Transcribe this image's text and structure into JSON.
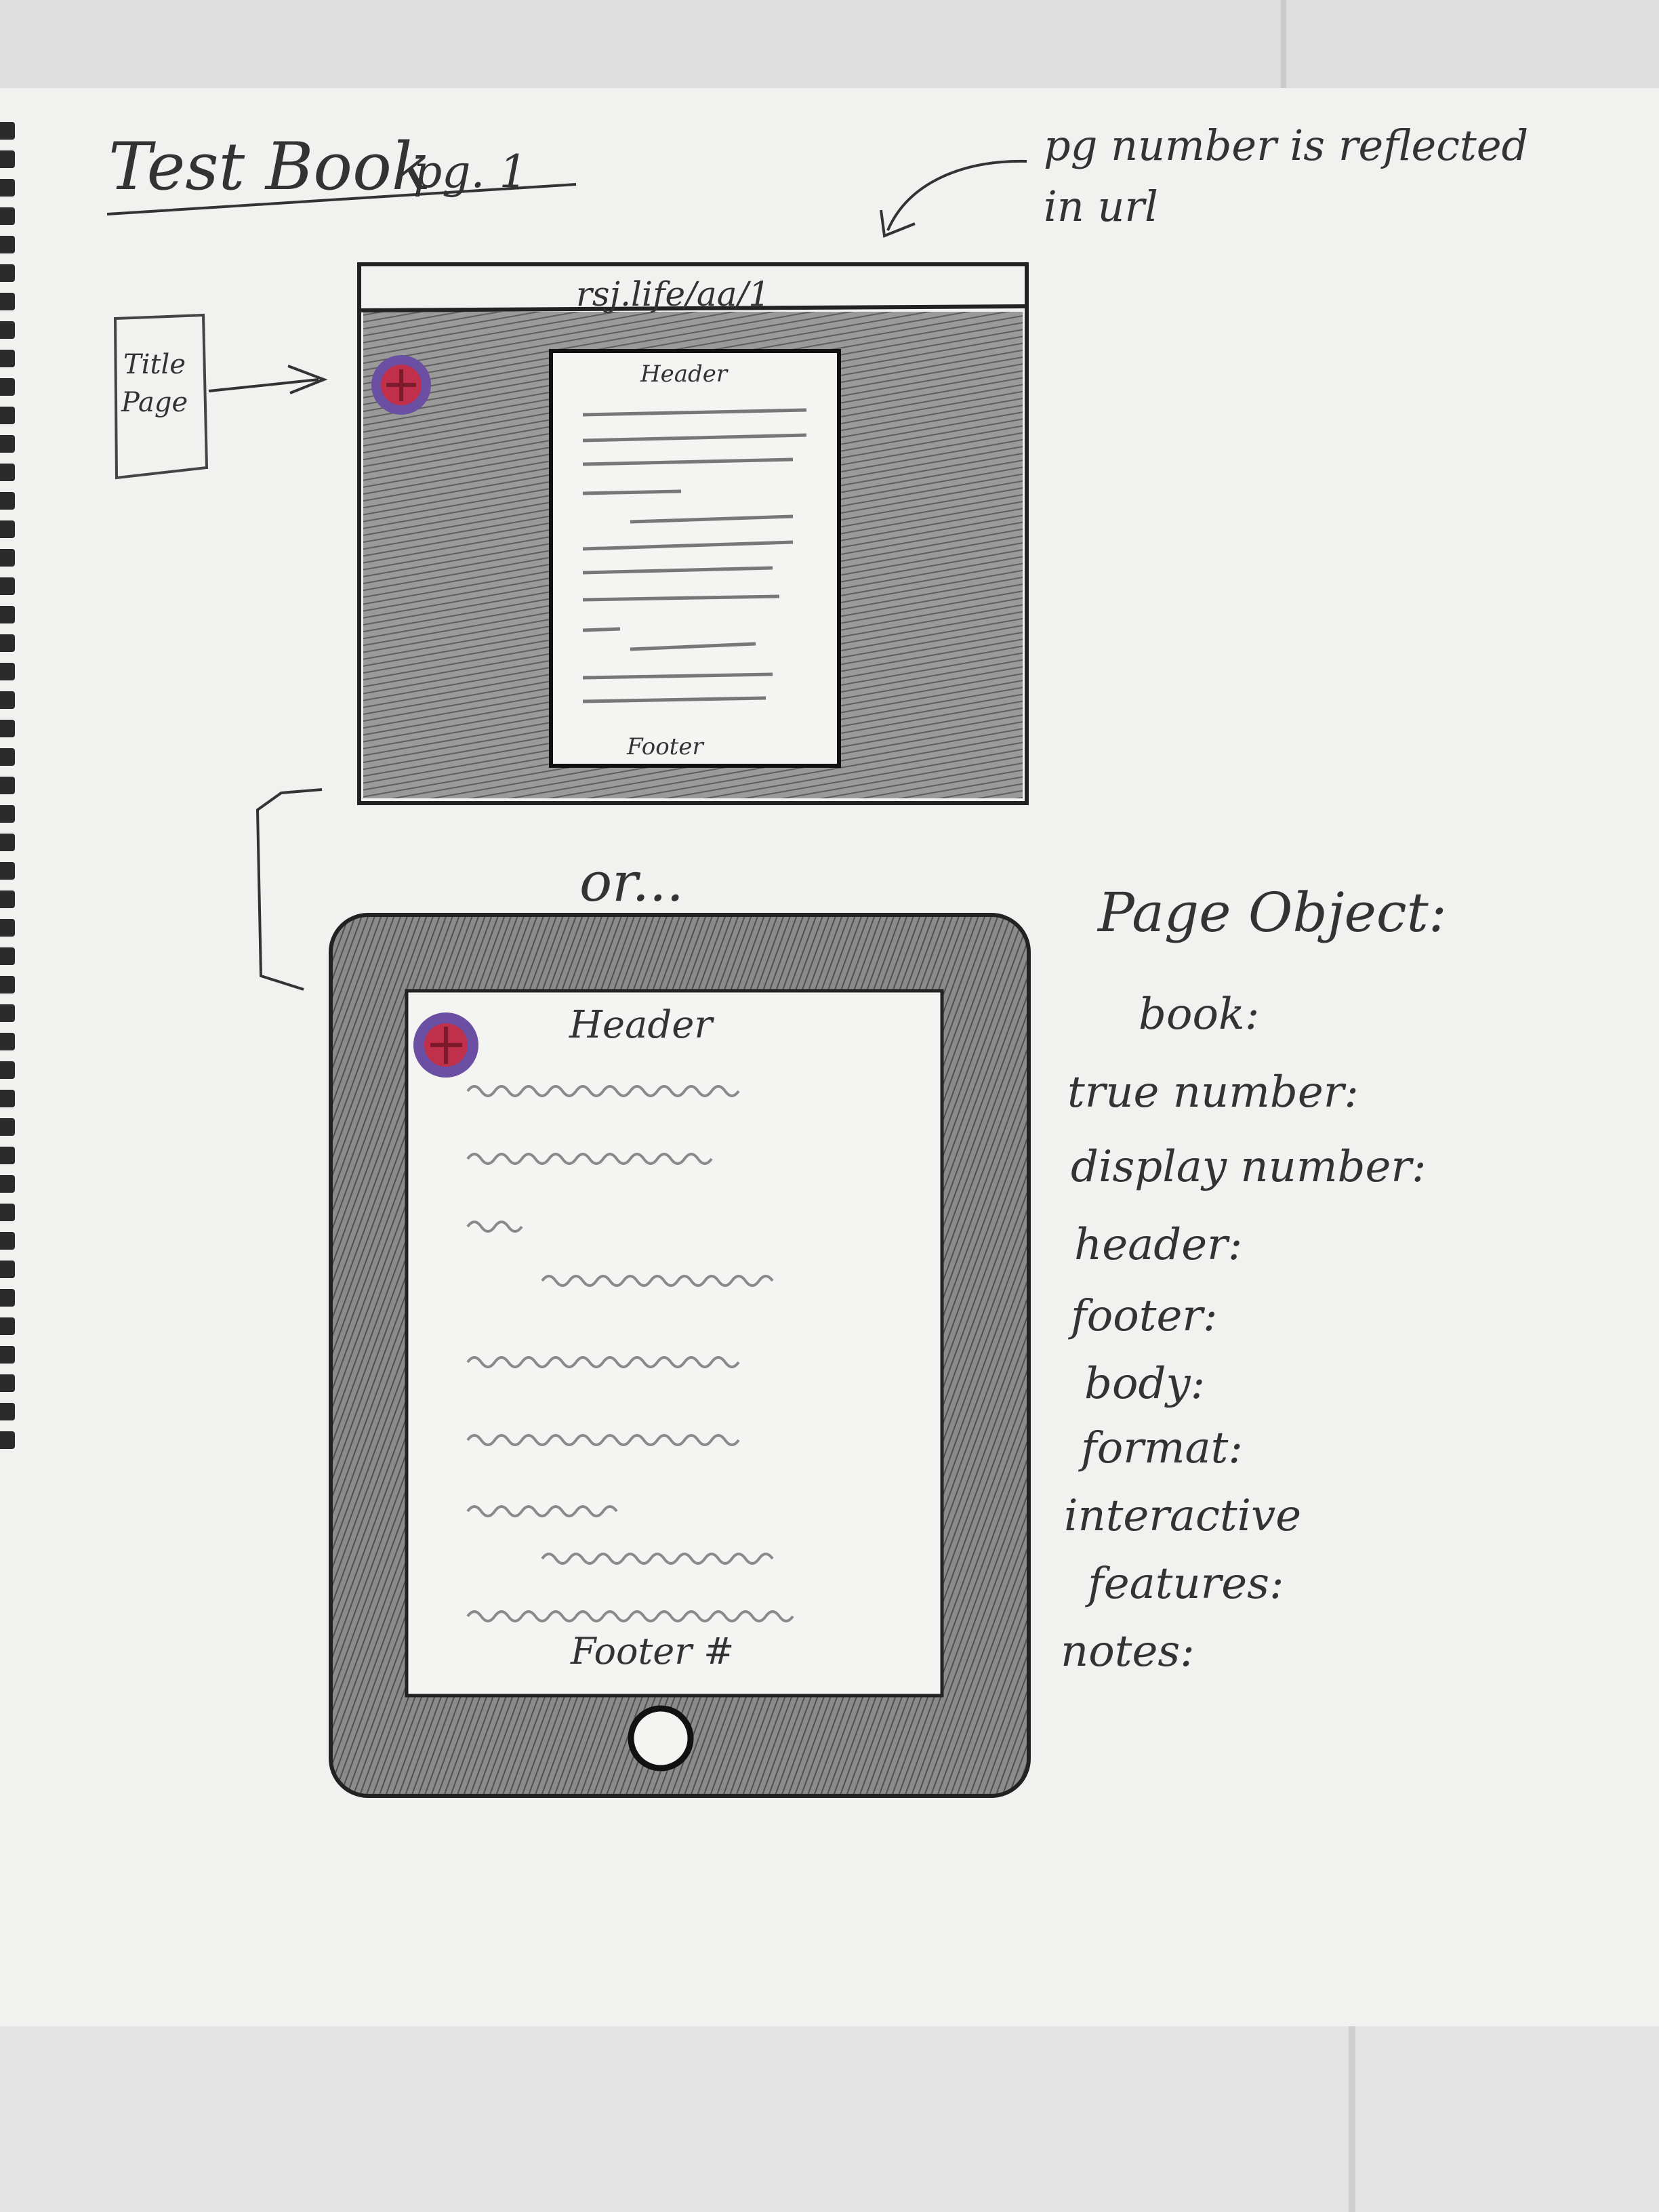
{
  "title": "Test Book",
  "page_label": "pg. 1",
  "url_note": "pg number is reflected in url",
  "title_page_label": "Title Page",
  "desktop": {
    "url": "rsj.life/aa/1",
    "header": "Header",
    "footer": "Footer"
  },
  "or_label": "or...",
  "tablet": {
    "header": "Header",
    "footer": "Footer #"
  },
  "page_object": {
    "heading": "Page Object:",
    "fields": [
      "book:",
      "true number:",
      "display number:",
      "header:",
      "footer:",
      "body:",
      "format:",
      "interactive",
      "features:",
      "notes:"
    ]
  },
  "colors": {
    "pencil": "#333333",
    "shading": "#7a7a7a",
    "logo_ring": "#6a4fa3",
    "logo_fill": "#c0304a"
  }
}
